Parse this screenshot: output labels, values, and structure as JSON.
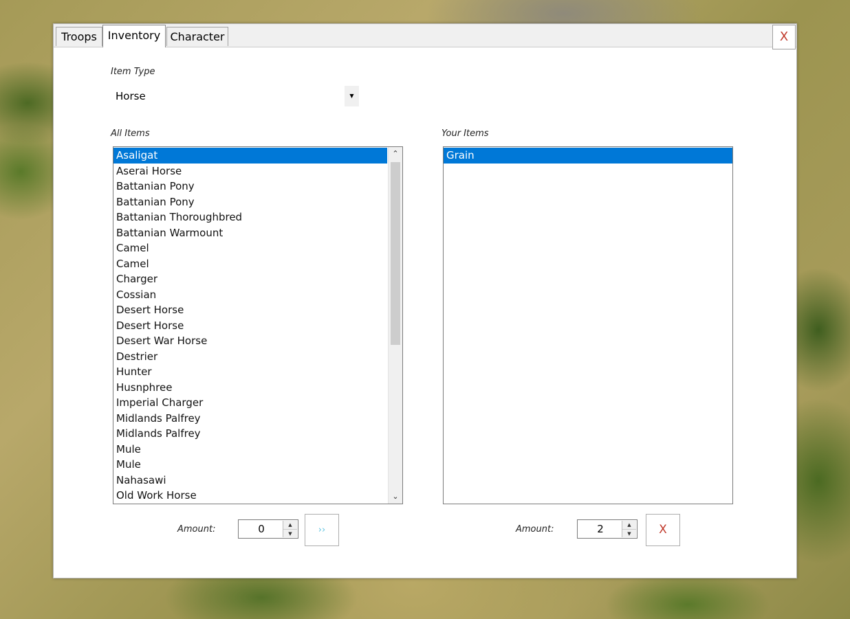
{
  "tabs": [
    "Troops",
    "Inventory",
    "Character"
  ],
  "close_label": "X",
  "item_type": {
    "label": "Item Type",
    "selected": "Horse"
  },
  "all_items": {
    "label": "All Items",
    "items": [
      "Asaligat",
      "Aserai Horse",
      "Battanian Pony",
      "Battanian Pony",
      "Battanian Thoroughbred",
      "Battanian Warmount",
      "Camel",
      "Camel",
      "Charger",
      "Cossian",
      "Desert Horse",
      "Desert Horse",
      "Desert War Horse",
      "Destrier",
      "Hunter",
      "Husnphree",
      "Imperial Charger",
      "Midlands Palfrey",
      "Midlands Palfrey",
      "Mule",
      "Mule",
      "Nahasawi",
      "Old Work Horse"
    ],
    "selected_index": 0
  },
  "your_items": {
    "label": "Your Items",
    "items": [
      "Grain"
    ],
    "selected_index": 0
  },
  "left_amount": {
    "label": "Amount:",
    "value": "0",
    "action_label": "››"
  },
  "right_amount": {
    "label": "Amount:",
    "value": "2",
    "action_label": "X"
  },
  "colors": {
    "selection": "#0078d7",
    "remove": "#c0392b",
    "add_arrow": "#5fc4e0"
  },
  "icons": {
    "combo": "dropdown-arrow-icon",
    "scroll_up": "chevron-up-icon",
    "scroll_down": "chevron-down-icon",
    "spin_up": "spin-up-icon",
    "spin_down": "spin-down-icon"
  }
}
